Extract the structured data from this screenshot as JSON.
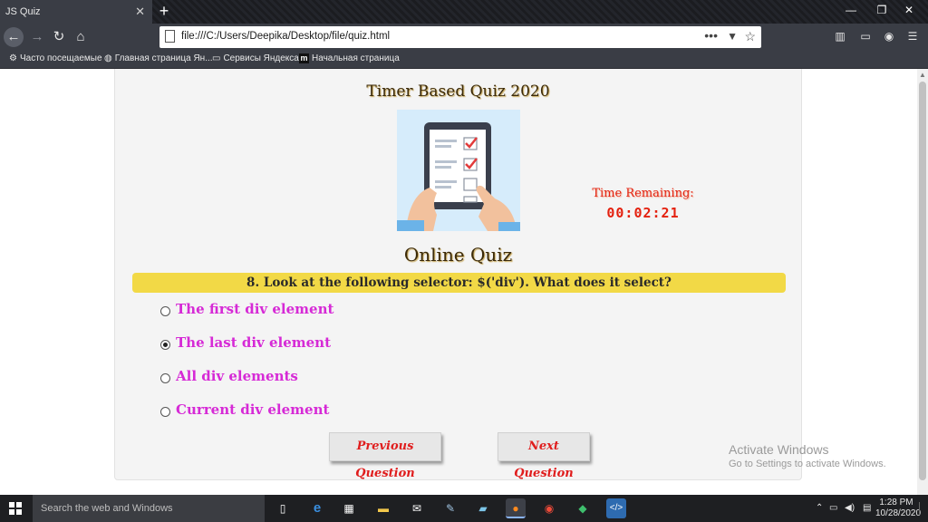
{
  "browser": {
    "tab_title": "JS Quiz",
    "url": "file:///C:/Users/Deepika/Desktop/file/quiz.html",
    "bookmarks": [
      {
        "label": "Часто посещаемые",
        "icon": "gear-icon"
      },
      {
        "label": "Главная страница Ян...",
        "icon": "globe-icon"
      },
      {
        "label": "Сервисы Яндекса",
        "icon": "folder-icon"
      },
      {
        "label": "Начальная страница",
        "icon": "m-icon"
      }
    ]
  },
  "quiz": {
    "title": "Timer Based Quiz 2020",
    "timer_label": "Time Remaining:",
    "timer_value": "00:02:21",
    "heading": "Online Quiz",
    "question": "8. Look at the following selector: $('div'). What does it select?",
    "options": [
      {
        "label": "The first div element",
        "selected": false
      },
      {
        "label": "The last div element",
        "selected": true
      },
      {
        "label": "All div elements",
        "selected": false
      },
      {
        "label": "Current div element",
        "selected": false
      }
    ],
    "prev_label": "Previous Question",
    "next_label": "Next Question"
  },
  "watermark": {
    "title": "Activate Windows",
    "subtitle": "Go to Settings to activate Windows."
  },
  "taskbar": {
    "search_placeholder": "Search the web and Windows",
    "time": "1:28 PM",
    "date": "10/28/2020"
  },
  "colors": {
    "question_bar": "#f2d946",
    "option_text": "#d62ad6",
    "timer_text": "#e4210f",
    "button_text": "#e01d1d"
  }
}
